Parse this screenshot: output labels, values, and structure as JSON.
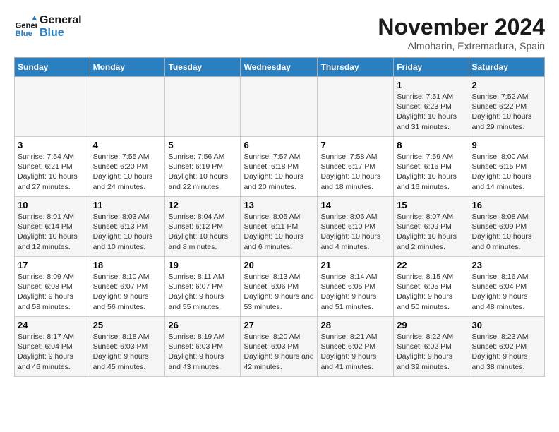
{
  "logo": {
    "line1": "General",
    "line2": "Blue"
  },
  "title": "November 2024",
  "subtitle": "Almoharin, Extremadura, Spain",
  "weekdays": [
    "Sunday",
    "Monday",
    "Tuesday",
    "Wednesday",
    "Thursday",
    "Friday",
    "Saturday"
  ],
  "weeks": [
    [
      {
        "day": "",
        "info": ""
      },
      {
        "day": "",
        "info": ""
      },
      {
        "day": "",
        "info": ""
      },
      {
        "day": "",
        "info": ""
      },
      {
        "day": "",
        "info": ""
      },
      {
        "day": "1",
        "info": "Sunrise: 7:51 AM\nSunset: 6:23 PM\nDaylight: 10 hours and 31 minutes."
      },
      {
        "day": "2",
        "info": "Sunrise: 7:52 AM\nSunset: 6:22 PM\nDaylight: 10 hours and 29 minutes."
      }
    ],
    [
      {
        "day": "3",
        "info": "Sunrise: 7:54 AM\nSunset: 6:21 PM\nDaylight: 10 hours and 27 minutes."
      },
      {
        "day": "4",
        "info": "Sunrise: 7:55 AM\nSunset: 6:20 PM\nDaylight: 10 hours and 24 minutes."
      },
      {
        "day": "5",
        "info": "Sunrise: 7:56 AM\nSunset: 6:19 PM\nDaylight: 10 hours and 22 minutes."
      },
      {
        "day": "6",
        "info": "Sunrise: 7:57 AM\nSunset: 6:18 PM\nDaylight: 10 hours and 20 minutes."
      },
      {
        "day": "7",
        "info": "Sunrise: 7:58 AM\nSunset: 6:17 PM\nDaylight: 10 hours and 18 minutes."
      },
      {
        "day": "8",
        "info": "Sunrise: 7:59 AM\nSunset: 6:16 PM\nDaylight: 10 hours and 16 minutes."
      },
      {
        "day": "9",
        "info": "Sunrise: 8:00 AM\nSunset: 6:15 PM\nDaylight: 10 hours and 14 minutes."
      }
    ],
    [
      {
        "day": "10",
        "info": "Sunrise: 8:01 AM\nSunset: 6:14 PM\nDaylight: 10 hours and 12 minutes."
      },
      {
        "day": "11",
        "info": "Sunrise: 8:03 AM\nSunset: 6:13 PM\nDaylight: 10 hours and 10 minutes."
      },
      {
        "day": "12",
        "info": "Sunrise: 8:04 AM\nSunset: 6:12 PM\nDaylight: 10 hours and 8 minutes."
      },
      {
        "day": "13",
        "info": "Sunrise: 8:05 AM\nSunset: 6:11 PM\nDaylight: 10 hours and 6 minutes."
      },
      {
        "day": "14",
        "info": "Sunrise: 8:06 AM\nSunset: 6:10 PM\nDaylight: 10 hours and 4 minutes."
      },
      {
        "day": "15",
        "info": "Sunrise: 8:07 AM\nSunset: 6:09 PM\nDaylight: 10 hours and 2 minutes."
      },
      {
        "day": "16",
        "info": "Sunrise: 8:08 AM\nSunset: 6:09 PM\nDaylight: 10 hours and 0 minutes."
      }
    ],
    [
      {
        "day": "17",
        "info": "Sunrise: 8:09 AM\nSunset: 6:08 PM\nDaylight: 9 hours and 58 minutes."
      },
      {
        "day": "18",
        "info": "Sunrise: 8:10 AM\nSunset: 6:07 PM\nDaylight: 9 hours and 56 minutes."
      },
      {
        "day": "19",
        "info": "Sunrise: 8:11 AM\nSunset: 6:07 PM\nDaylight: 9 hours and 55 minutes."
      },
      {
        "day": "20",
        "info": "Sunrise: 8:13 AM\nSunset: 6:06 PM\nDaylight: 9 hours and 53 minutes."
      },
      {
        "day": "21",
        "info": "Sunrise: 8:14 AM\nSunset: 6:05 PM\nDaylight: 9 hours and 51 minutes."
      },
      {
        "day": "22",
        "info": "Sunrise: 8:15 AM\nSunset: 6:05 PM\nDaylight: 9 hours and 50 minutes."
      },
      {
        "day": "23",
        "info": "Sunrise: 8:16 AM\nSunset: 6:04 PM\nDaylight: 9 hours and 48 minutes."
      }
    ],
    [
      {
        "day": "24",
        "info": "Sunrise: 8:17 AM\nSunset: 6:04 PM\nDaylight: 9 hours and 46 minutes."
      },
      {
        "day": "25",
        "info": "Sunrise: 8:18 AM\nSunset: 6:03 PM\nDaylight: 9 hours and 45 minutes."
      },
      {
        "day": "26",
        "info": "Sunrise: 8:19 AM\nSunset: 6:03 PM\nDaylight: 9 hours and 43 minutes."
      },
      {
        "day": "27",
        "info": "Sunrise: 8:20 AM\nSunset: 6:03 PM\nDaylight: 9 hours and 42 minutes."
      },
      {
        "day": "28",
        "info": "Sunrise: 8:21 AM\nSunset: 6:02 PM\nDaylight: 9 hours and 41 minutes."
      },
      {
        "day": "29",
        "info": "Sunrise: 8:22 AM\nSunset: 6:02 PM\nDaylight: 9 hours and 39 minutes."
      },
      {
        "day": "30",
        "info": "Sunrise: 8:23 AM\nSunset: 6:02 PM\nDaylight: 9 hours and 38 minutes."
      }
    ]
  ]
}
